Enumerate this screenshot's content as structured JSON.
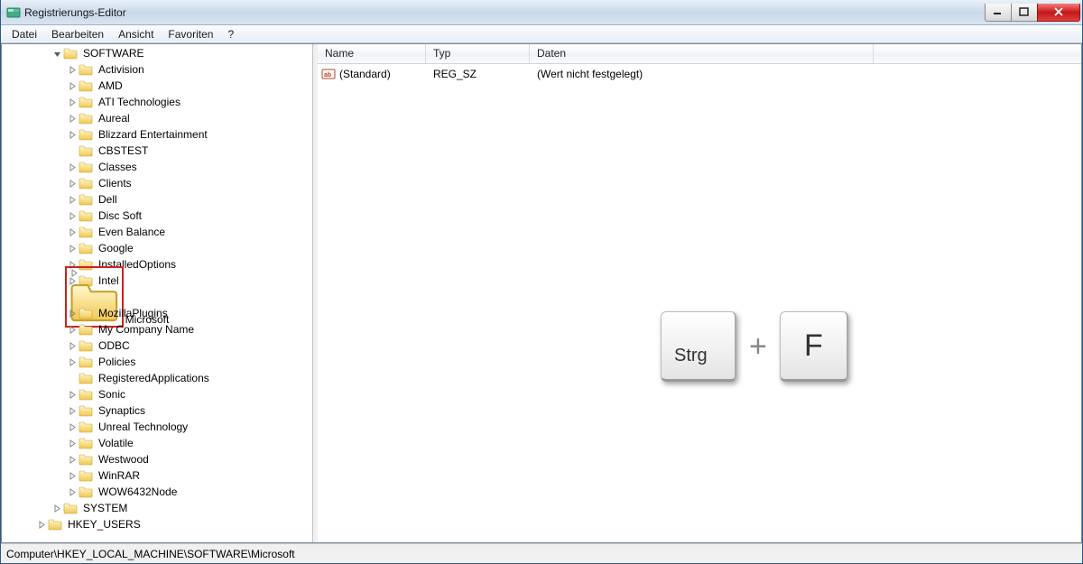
{
  "window": {
    "title": "Registrierungs-Editor"
  },
  "menubar": [
    "Datei",
    "Bearbeiten",
    "Ansicht",
    "Favoriten",
    "?"
  ],
  "tree": {
    "root": {
      "label": "SOFTWARE",
      "expanded": true,
      "indent": 55
    },
    "children_indent": 72,
    "children": [
      {
        "label": "Activision",
        "expandable": true
      },
      {
        "label": "AMD",
        "expandable": true
      },
      {
        "label": "ATI Technologies",
        "expandable": true
      },
      {
        "label": "Aureal",
        "expandable": true
      },
      {
        "label": "Blizzard Entertainment",
        "expandable": true
      },
      {
        "label": "CBSTEST",
        "expandable": false
      },
      {
        "label": "Classes",
        "expandable": true
      },
      {
        "label": "Clients",
        "expandable": true
      },
      {
        "label": "Dell",
        "expandable": true
      },
      {
        "label": "Disc Soft",
        "expandable": true
      },
      {
        "label": "Even Balance",
        "expandable": true
      },
      {
        "label": "Google",
        "expandable": true
      },
      {
        "label": "InstalledOptions",
        "expandable": true
      },
      {
        "label": "Intel",
        "expandable": true
      },
      {
        "label": "Microsoft",
        "expandable": true,
        "highlighted": true
      },
      {
        "label": "MozillaPlugins",
        "expandable": true
      },
      {
        "label": "My Company Name",
        "expandable": true
      },
      {
        "label": "ODBC",
        "expandable": true
      },
      {
        "label": "Policies",
        "expandable": true
      },
      {
        "label": "RegisteredApplications",
        "expandable": false
      },
      {
        "label": "Sonic",
        "expandable": true
      },
      {
        "label": "Synaptics",
        "expandable": true
      },
      {
        "label": "Unreal Technology",
        "expandable": true
      },
      {
        "label": "Volatile",
        "expandable": true
      },
      {
        "label": "Westwood",
        "expandable": true
      },
      {
        "label": "WinRAR",
        "expandable": true
      },
      {
        "label": "WOW6432Node",
        "expandable": true
      }
    ],
    "siblings": [
      {
        "label": "SYSTEM",
        "indent": 55,
        "expandable": true
      },
      {
        "label": "HKEY_USERS",
        "indent": 38,
        "expandable": true
      }
    ]
  },
  "list": {
    "columns": {
      "name": "Name",
      "typ": "Typ",
      "daten": "Daten"
    },
    "rows": [
      {
        "name": "(Standard)",
        "typ": "REG_SZ",
        "daten": "(Wert nicht festgelegt)"
      }
    ]
  },
  "statusbar": "Computer\\HKEY_LOCAL_MACHINE\\SOFTWARE\\Microsoft",
  "overlay": {
    "key1": "Strg",
    "plus": "+",
    "key2": "F"
  }
}
